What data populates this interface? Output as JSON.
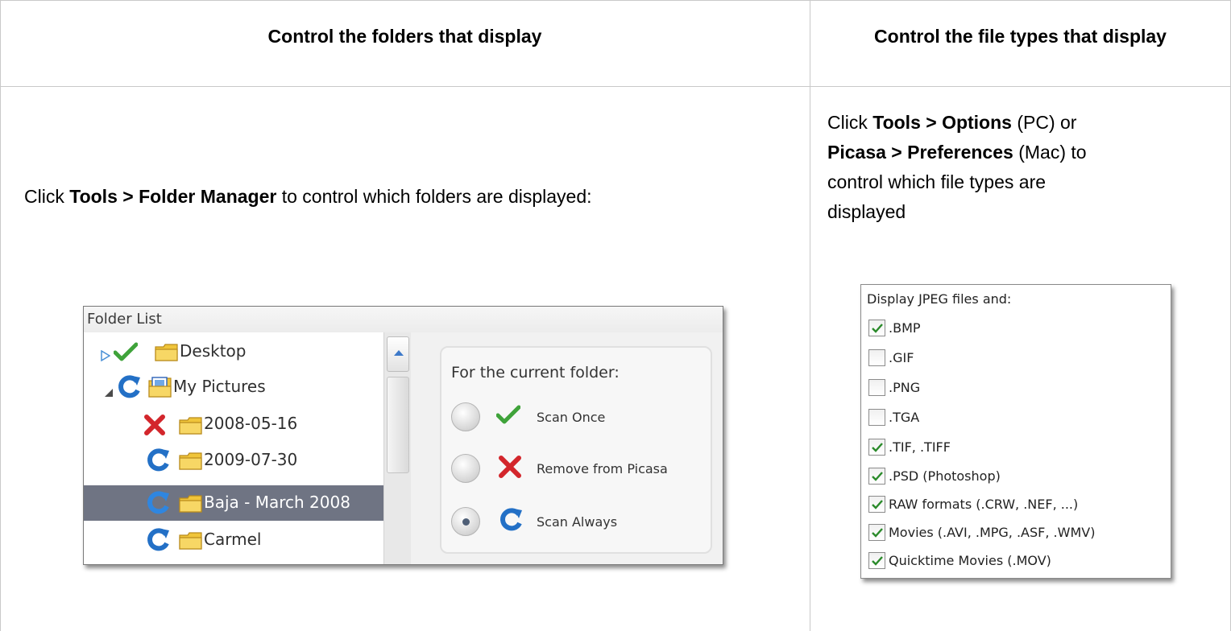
{
  "header": {
    "left": "Control the folders that display",
    "right": "Control the file types that display"
  },
  "left_text": {
    "pre": "Click ",
    "bold": "Tools > Folder Manager",
    "post": " to control which folders are displayed:"
  },
  "right_text": {
    "line1_pre": "Click ",
    "line1_bold": "Tools > Options",
    "line1_post": " (PC) or",
    "line2_bold": "Picasa > Preferences",
    "line2_post": " (Mac) to",
    "line3": "control which file types are",
    "line4": "displayed"
  },
  "folder_manager": {
    "title": "Folder List",
    "folders": [
      {
        "name": "Desktop",
        "status": "check-icon",
        "expander": "collapsed-triangle-icon",
        "folder": "folder-icon"
      },
      {
        "name": "My Pictures",
        "status": "refresh-icon",
        "expander": "expanded-triangle-icon",
        "folder": "my-pictures-folder-icon"
      },
      {
        "name": "2008-05-16",
        "status": "remove-x-icon",
        "folder": "folder-icon"
      },
      {
        "name": "2009-07-30",
        "status": "refresh-icon",
        "folder": "folder-icon"
      },
      {
        "name": "Baja - March 2008",
        "status": "refresh-icon",
        "folder": "folder-icon",
        "selected": true
      },
      {
        "name": "Carmel",
        "status": "refresh-icon",
        "folder": "folder-icon"
      }
    ],
    "options_title": "For the current folder:",
    "options": [
      {
        "label": "Scan Once",
        "icon": "check-icon",
        "selected": false
      },
      {
        "label": "Remove from Picasa",
        "icon": "remove-x-icon",
        "selected": false
      },
      {
        "label": "Scan Always",
        "icon": "refresh-icon",
        "selected": true
      }
    ]
  },
  "file_types": {
    "title": "Display JPEG files and:",
    "items": [
      {
        "label": ".BMP",
        "checked": true
      },
      {
        "label": ".GIF",
        "checked": false
      },
      {
        "label": ".PNG",
        "checked": false
      },
      {
        "label": ".TGA",
        "checked": false
      },
      {
        "label": ".TIF, .TIFF",
        "checked": true
      },
      {
        "label": ".PSD (Photoshop)",
        "checked": true
      },
      {
        "label": "RAW formats (.CRW, .NEF, ...)",
        "checked": true
      },
      {
        "label": "Movies (.AVI, .MPG, .ASF, .WMV)",
        "checked": true
      },
      {
        "label": "Quicktime Movies (.MOV)",
        "checked": true
      }
    ]
  },
  "colors": {
    "check": "#3fa33a",
    "remove": "#d3262c",
    "refresh": "#2370c6",
    "folder": "#f0c53a",
    "selected_row": "#6f7483",
    "grid_line": "#c9c9c9"
  }
}
